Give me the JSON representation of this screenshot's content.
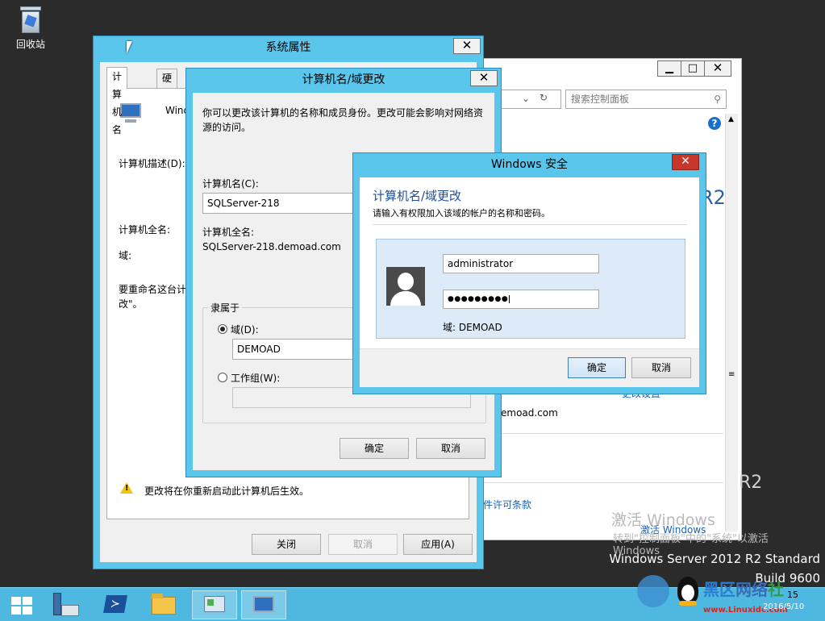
{
  "desktop": {
    "recycle_bin_label": "回收站"
  },
  "control_panel": {
    "search_placeholder": "搜索控制面板",
    "partial_domain": "emoad.com",
    "partial_change_settings": "更改设置",
    "partial_license": "件许可条款",
    "partial_r2": "R2"
  },
  "system_properties": {
    "title": "系统属性",
    "tabs": [
      "计算机名",
      "硬件"
    ],
    "partial_win": "Wind",
    "desc_label": "计算机描述(D):",
    "fullname_label": "计算机全名:",
    "domain_label": "域:",
    "rename_text_1": "要重命名这台计",
    "rename_text_2": "改\"。",
    "warning_text": "更改将在你重新启动此计算机后生效。",
    "close_btn": "关闭",
    "cancel_btn": "取消",
    "apply_btn": "应用(A)"
  },
  "name_change": {
    "title": "计算机名/域更改",
    "intro_1": "你可以更改该计算机的名称和成员身份。更改可能会影响对网络资",
    "intro_2": "源的访问。",
    "computer_name_label": "计算机名(C):",
    "computer_name_value": "SQLServer-218",
    "fullname_label": "计算机全名:",
    "fullname_value": "SQLServer-218.demoad.com",
    "member_of": "隶属于",
    "domain_radio": "域(D):",
    "domain_value": "DEMOAD",
    "workgroup_radio": "工作组(W):",
    "ok_btn": "确定",
    "cancel_btn": "取消"
  },
  "windows_security": {
    "title": "Windows 安全",
    "heading": "计算机名/域更改",
    "subheading": "请输入有权限加入该域的帐户的名称和密码。",
    "username": "administrator",
    "password_mask": "●●●●●●●●●",
    "domain_line": "域: DEMOAD",
    "ok_btn": "确定",
    "cancel_btn": "取消"
  },
  "activation": {
    "line1": "激活 Windows",
    "line2_link": "激活 Windows",
    "line3": "转到\"控制面板\"中的\"系统\"以激活",
    "line4": "Windows"
  },
  "os_info": {
    "edition": "Windows Server 2012 R2 Standard",
    "build": "Build 9600",
    "r2": "R2"
  },
  "watermark": {
    "site": "www.Linuxidc.com",
    "brand_1": "黑区",
    "brand_2": "网络",
    "brand_3": "社"
  },
  "taskbar": {
    "clock_partial": "15",
    "date_partial": "2016/5/10"
  }
}
